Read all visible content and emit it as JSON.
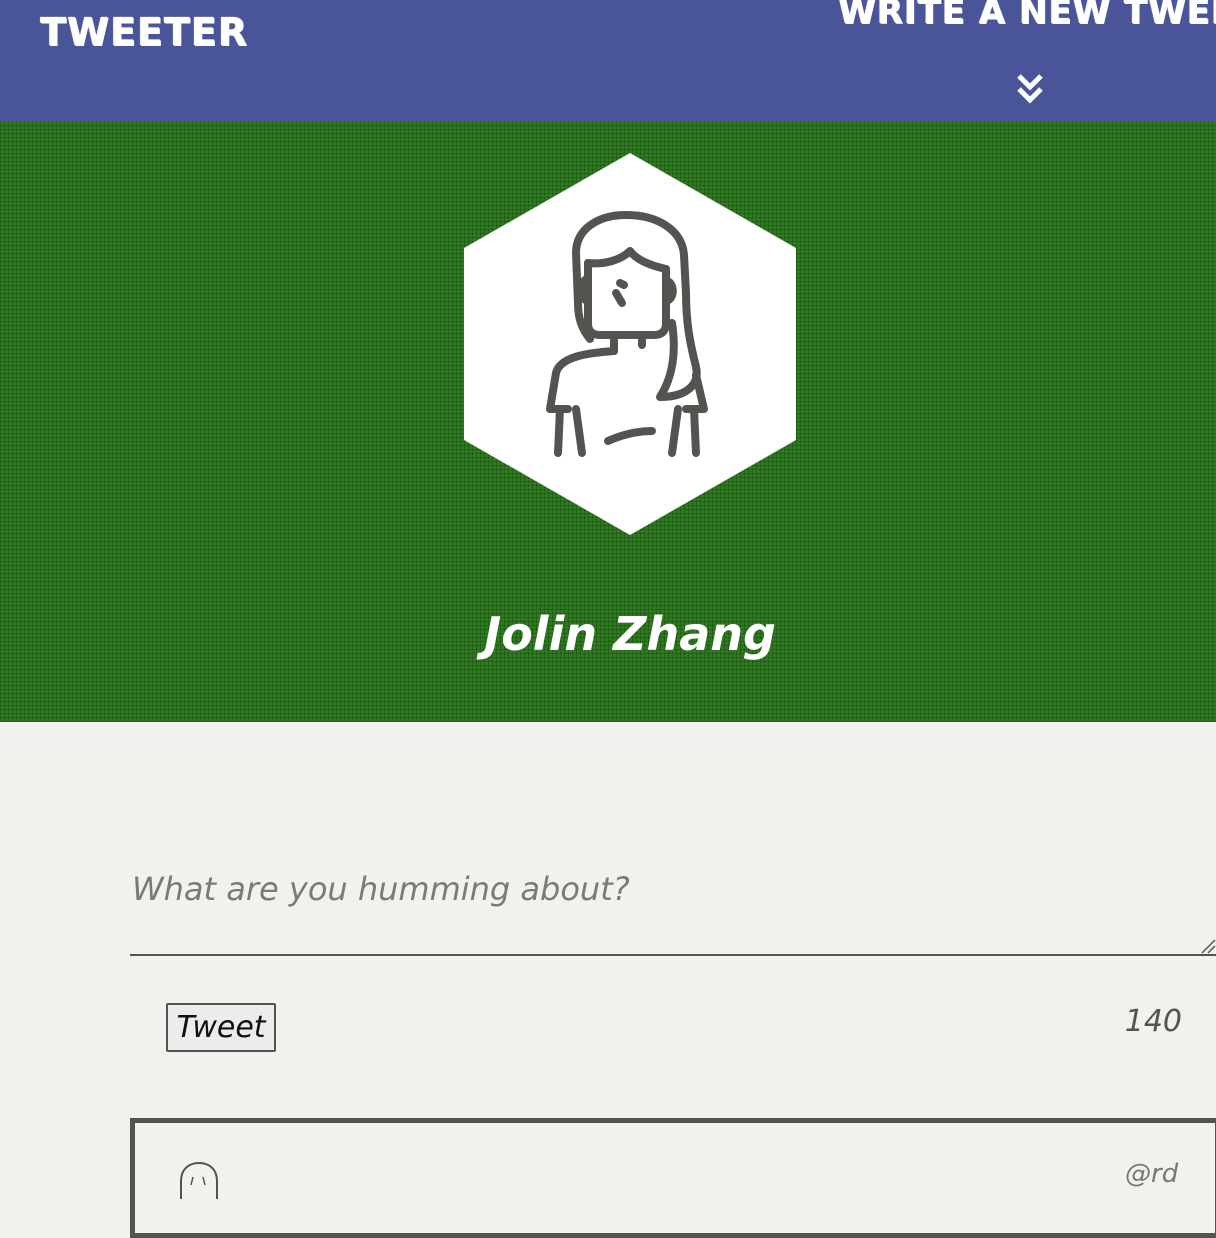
{
  "nav": {
    "brand": "TWEETER",
    "compose_toggle_label": "WRITE A NEW TWEET",
    "compose_toggle_icon": "double-chevron-down-icon"
  },
  "profile": {
    "name": "Jolin Zhang",
    "avatar_icon": "woman-avatar-icon"
  },
  "compose": {
    "placeholder": "What are you humming about?",
    "value": "",
    "submit_label": "Tweet",
    "char_count": "140"
  },
  "tweets": [
    {
      "avatar_icon": "user-avatar-icon",
      "handle": "@rd"
    }
  ],
  "colors": {
    "nav_bg": "#4a5599",
    "header_bg": "#2f7a21",
    "page_bg": "#f3f1ed",
    "text_dark": "#555350"
  }
}
